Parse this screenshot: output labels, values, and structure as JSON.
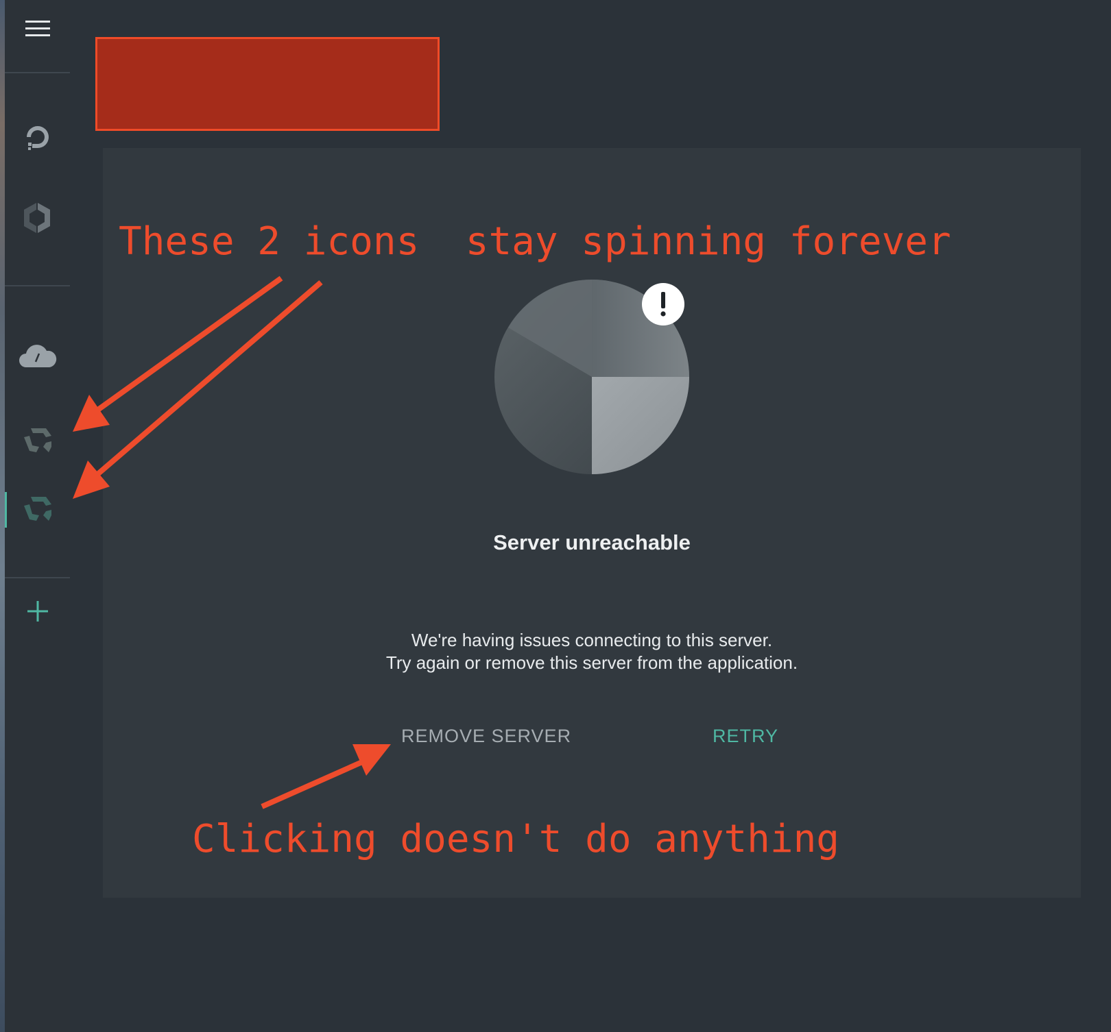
{
  "sidebar": {
    "icons": [
      {
        "name": "hamburger-menu-icon"
      },
      {
        "name": "digitalocean-icon"
      },
      {
        "name": "hexagon-logo-icon"
      },
      {
        "name": "cloud-icon"
      },
      {
        "name": "spinning-server-icon"
      },
      {
        "name": "spinning-server-active-icon"
      },
      {
        "name": "plus-icon"
      }
    ],
    "accent_color": "#4fb8a3"
  },
  "main": {
    "status_title": "Server unreachable",
    "description_line1": "We're having issues connecting to this server.",
    "description_line2": "Try again or remove this server from the application.",
    "remove_button_label": "REMOVE SERVER",
    "retry_button_label": "RETRY",
    "status_icon": "exclamation-badge-icon"
  },
  "annotations": {
    "top_note": "These 2 icons  stay spinning forever",
    "bottom_note": "Clicking doesn't do anything",
    "color": "#ee4c2c"
  },
  "redaction_color": "#a52c1a"
}
